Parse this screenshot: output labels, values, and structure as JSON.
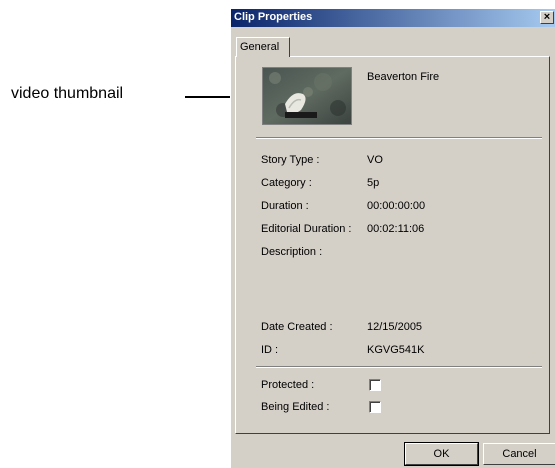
{
  "annotation": {
    "label": "video thumbnail"
  },
  "window": {
    "title": "Clip Properties",
    "close_label": "×"
  },
  "tabs": [
    {
      "label": "General"
    }
  ],
  "clip": {
    "name": "Beaverton Fire"
  },
  "fields": {
    "story_type": {
      "label": "Story Type :",
      "value": "VO"
    },
    "category": {
      "label": "Category :",
      "value": "5p"
    },
    "duration": {
      "label": "Duration :",
      "value": "00:00:00:00"
    },
    "editorial_duration": {
      "label": "Editorial Duration :",
      "value": "00:02:11:06"
    },
    "description": {
      "label": "Description :",
      "value": ""
    },
    "date_created": {
      "label": "Date Created :",
      "value": "12/15/2005"
    },
    "id": {
      "label": "ID :",
      "value": "KGVG541K"
    }
  },
  "flags": {
    "protected": {
      "label": "Protected :",
      "checked": false
    },
    "being_edited": {
      "label": "Being Edited :",
      "checked": false
    }
  },
  "buttons": {
    "ok": "OK",
    "cancel": "Cancel"
  }
}
